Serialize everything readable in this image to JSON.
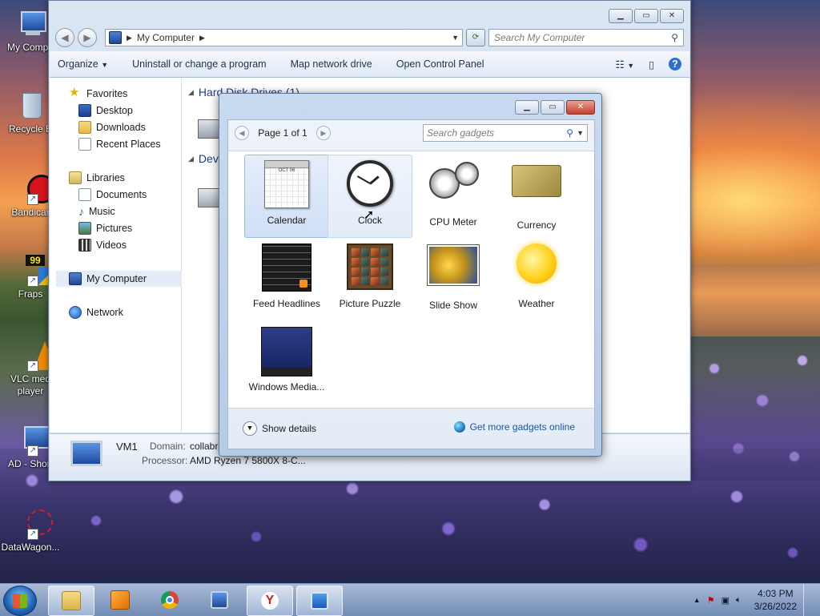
{
  "desktop": {
    "icons": [
      {
        "label": "My Compu"
      },
      {
        "label": "Recycle B"
      },
      {
        "label": "Bandicar"
      },
      {
        "label": "Fraps"
      },
      {
        "label": "VLC med"
      },
      {
        "label": "player"
      },
      {
        "label": "AD - Short"
      },
      {
        "label": "DataWagon..."
      }
    ],
    "fraps_badge": "99"
  },
  "explorer": {
    "address": "My Computer",
    "search_placeholder": "Search My Computer",
    "toolbar": {
      "organize": "Organize",
      "uninstall": "Uninstall or change a program",
      "map_drive": "Map network drive",
      "control_panel": "Open Control Panel"
    },
    "nav": {
      "favorites": "Favorites",
      "desktop": "Desktop",
      "downloads": "Downloads",
      "recent": "Recent Places",
      "libraries": "Libraries",
      "documents": "Documents",
      "music": "Music",
      "pictures": "Pictures",
      "videos": "Videos",
      "my_computer": "My Computer",
      "network": "Network"
    },
    "sections": {
      "hard_disk": "Hard Disk Drives (1)",
      "devices": "Dev"
    },
    "details": {
      "name": "VM1",
      "domain_label": "Domain:",
      "domain_value": "collabr",
      "processor_label": "Processor:",
      "processor_value": "AMD Ryzen 7 5800X 8-C..."
    }
  },
  "gadgets": {
    "page": "Page 1 of 1",
    "search_placeholder": "Search gadgets",
    "items": [
      {
        "name": "Calendar"
      },
      {
        "name": "Clock"
      },
      {
        "name": "CPU Meter"
      },
      {
        "name": "Currency"
      },
      {
        "name": "Feed Headlines"
      },
      {
        "name": "Picture Puzzle"
      },
      {
        "name": "Slide Show"
      },
      {
        "name": "Weather"
      },
      {
        "name": "Windows Media..."
      }
    ],
    "calendar_month": "OCT 06",
    "show_details": "Show details",
    "more_online": "Get more gadgets online"
  },
  "taskbar": {
    "time": "4:03 PM",
    "date": "3/26/2022"
  },
  "colors": {
    "link": "#1a55b0",
    "header_text": "#1e3a8a"
  }
}
